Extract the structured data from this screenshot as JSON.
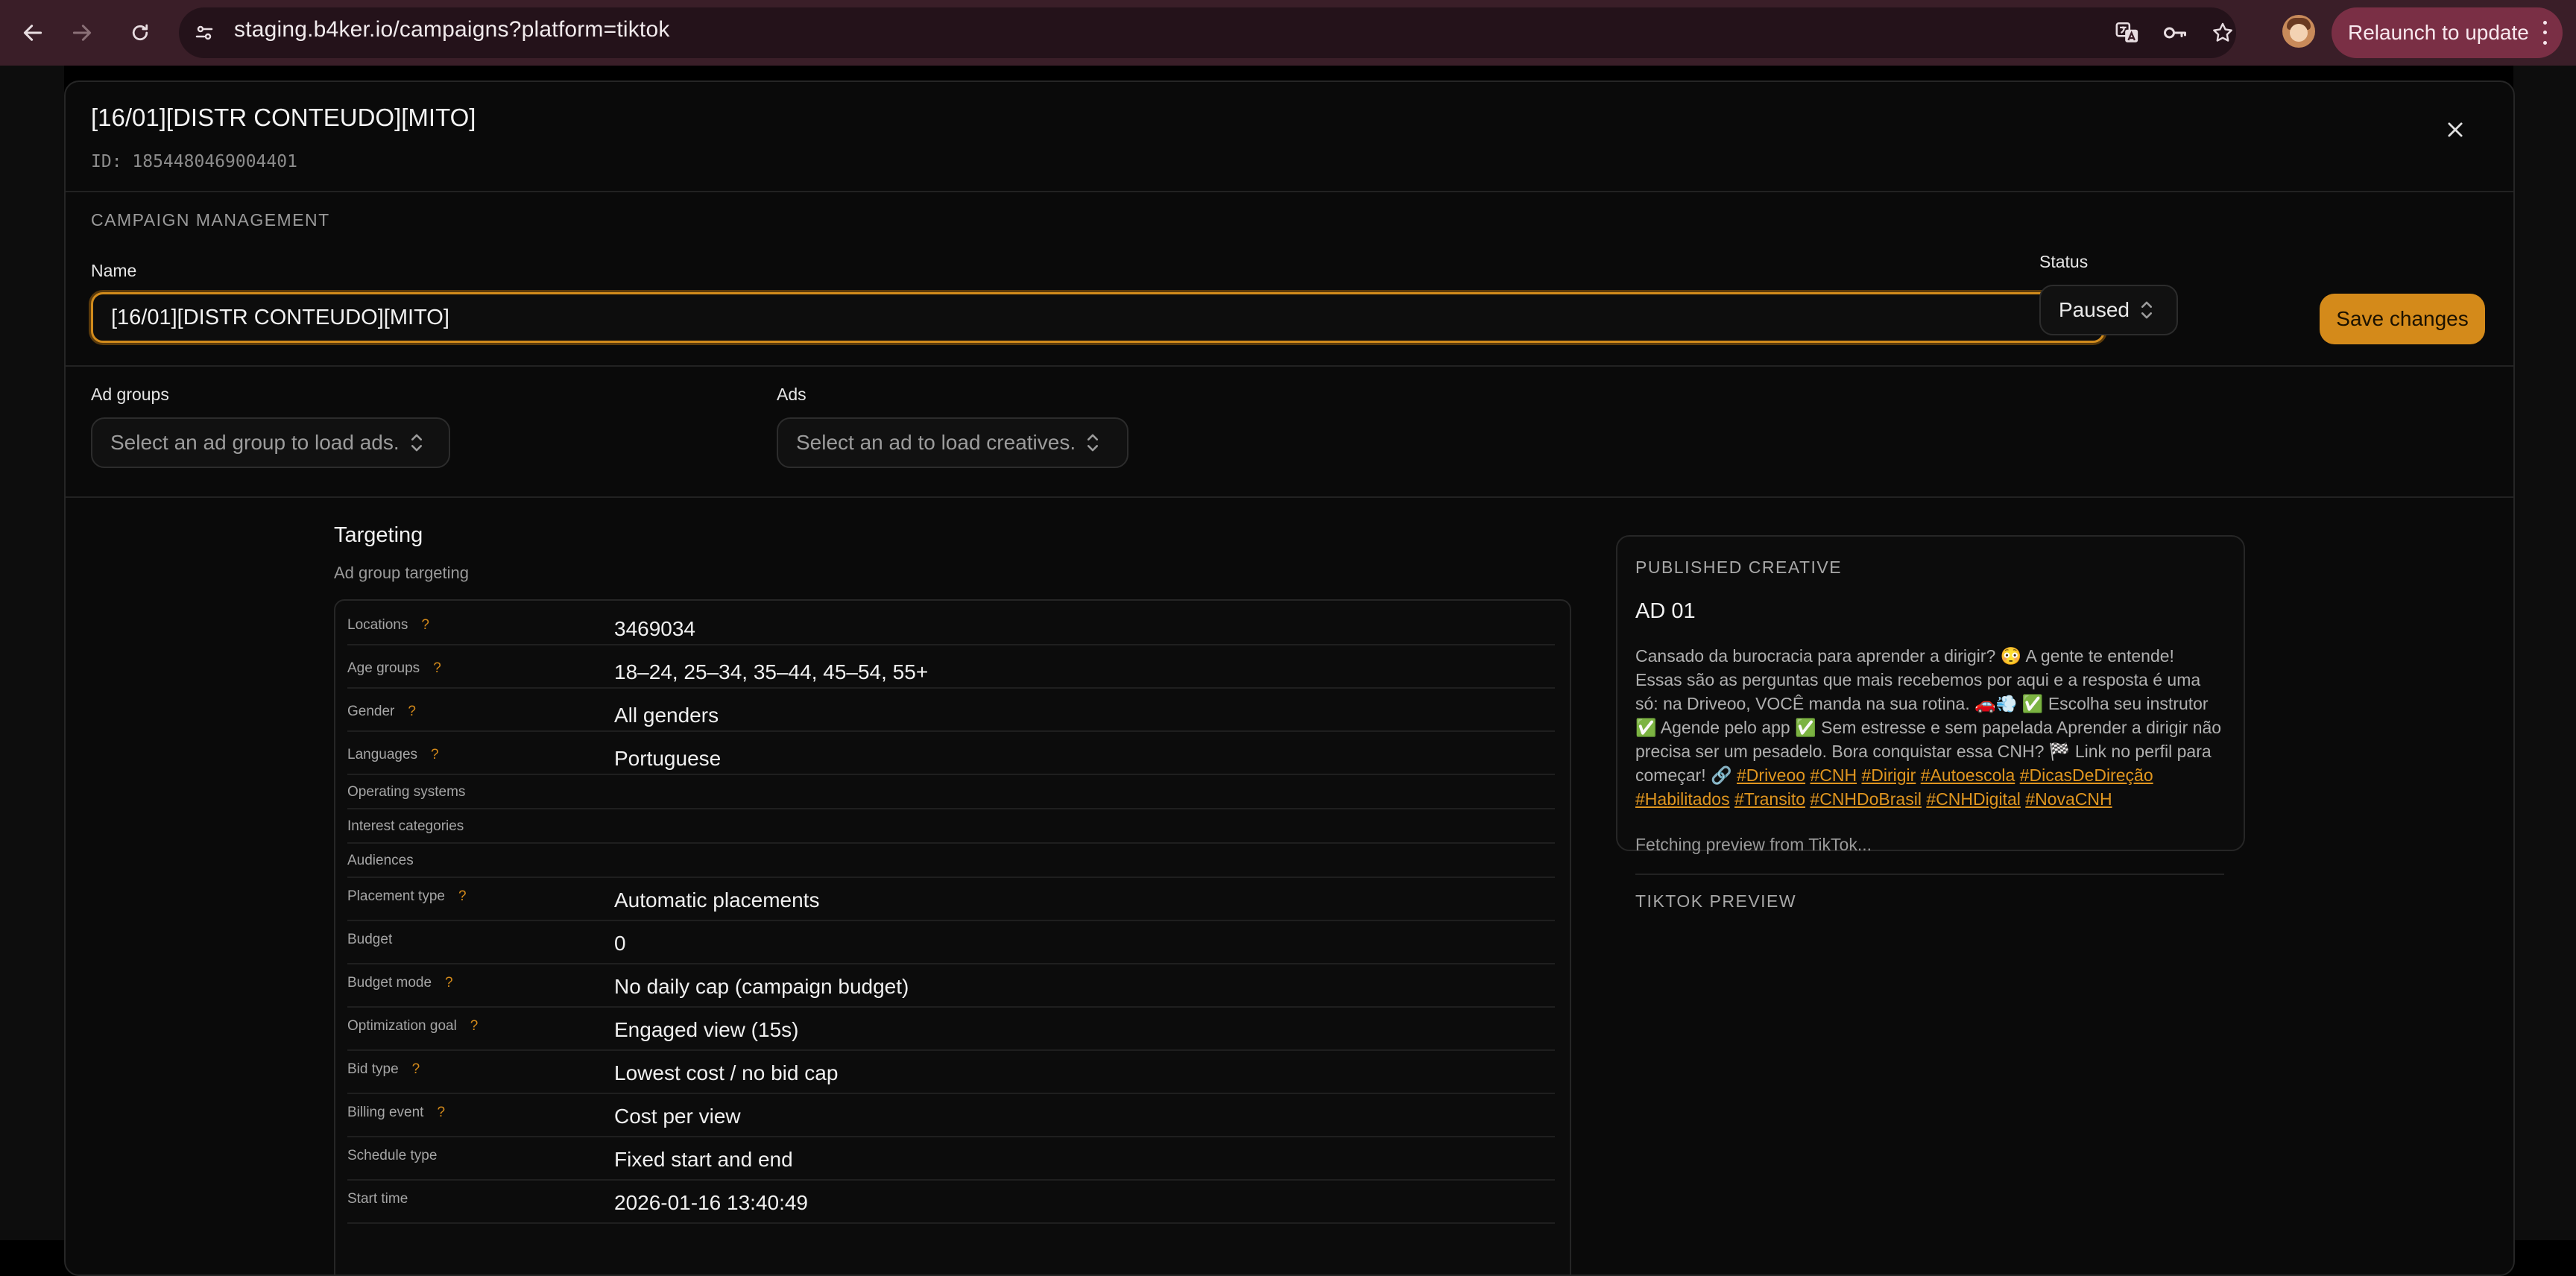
{
  "browser": {
    "url": "staging.b4ker.io/campaigns?platform=tiktok",
    "relaunch_label": "Relaunch to update"
  },
  "modal": {
    "title": "[16/01][DISTR CONTEUDO][MITO]",
    "id_text": "ID: 1854480469004401",
    "section_label": "CAMPAIGN MANAGEMENT",
    "name_label": "Name",
    "name_value": "[16/01][DISTR CONTEUDO][MITO]",
    "status_label": "Status",
    "status_value": "Paused",
    "save_label": "Save changes",
    "ad_groups_label": "Ad groups",
    "ad_groups_placeholder": "Select an ad group to load ads.",
    "ads_label": "Ads",
    "ads_placeholder": "Select an ad to load creatives."
  },
  "targeting": {
    "title": "Targeting",
    "subtitle": "Ad group targeting",
    "rows": [
      {
        "label": "Locations",
        "help": "?",
        "value": "3469034"
      },
      {
        "label": "Age groups",
        "help": "?",
        "value": "18–24, 25–34, 35–44, 45–54, 55+"
      },
      {
        "label": "Gender",
        "help": "?",
        "value": "All genders"
      },
      {
        "label": "Languages",
        "help": "?",
        "value": "Portuguese"
      },
      {
        "label": "Operating systems",
        "help": "",
        "value": ""
      },
      {
        "label": "Interest categories",
        "help": "",
        "value": ""
      },
      {
        "label": "Audiences",
        "help": "",
        "value": ""
      },
      {
        "label": "Placement type",
        "help": "?",
        "value": "Automatic placements"
      },
      {
        "label": "Budget",
        "help": "",
        "value": "0"
      },
      {
        "label": "Budget mode",
        "help": "?",
        "value": "No daily cap (campaign budget)"
      },
      {
        "label": "Optimization goal",
        "help": "?",
        "value": "Engaged view (15s)"
      },
      {
        "label": "Bid type",
        "help": "?",
        "value": "Lowest cost / no bid cap"
      },
      {
        "label": "Billing event",
        "help": "?",
        "value": "Cost per view"
      },
      {
        "label": "Schedule type",
        "help": "",
        "value": "Fixed start and end"
      },
      {
        "label": "Start time",
        "help": "",
        "value": "2026-01-16 13:40:49"
      }
    ]
  },
  "creative": {
    "section_label": "PUBLISHED CREATIVE",
    "ad_name": "AD 01",
    "caption_text": "Cansado da burocracia para aprender a dirigir? 😳 A gente te entende! Essas são as perguntas que mais recebemos por aqui e a resposta é uma só: na Driveoo, VOCÊ manda na sua rotina. 🚗💨 ✅ Escolha seu instrutor ✅ Agende pelo app ✅ Sem estresse e sem papelada Aprender a dirigir não precisa ser um pesadelo. Bora conquistar essa CNH? 🏁 Link no perfil para começar! 🔗",
    "hashtags": [
      "#Driveoo",
      "#CNH",
      "#Dirigir",
      "#Autoescola",
      "#DicasDeDireção",
      "#Habilitados",
      "#Transito",
      "#CNHDoBrasil",
      "#CNHDigital",
      "#NovaCNH"
    ],
    "fetching_text": "Fetching preview from TikTok...",
    "preview_label": "TIKTOK PREVIEW"
  },
  "colors": {
    "accent": "#d48a1a",
    "chrome": "#3a1e28",
    "relaunch": "#7a2f45"
  }
}
